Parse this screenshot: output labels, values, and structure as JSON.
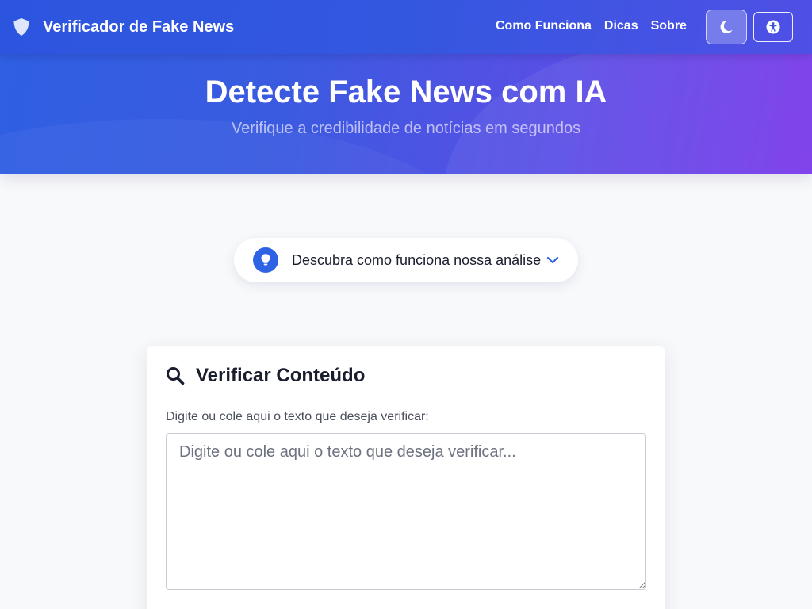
{
  "navbar": {
    "brand_title": "Verificador de Fake News",
    "brand_icon": "shield-icon",
    "links": [
      {
        "label": "Como Funciona"
      },
      {
        "label": "Dicas"
      },
      {
        "label": "Sobre"
      }
    ],
    "theme_toggle_icon": "moon-icon",
    "accessibility_icon": "accessibility-icon"
  },
  "hero": {
    "title": "Detecte Fake News com IA",
    "subtitle": "Verifique a credibilidade de notícias em segundos"
  },
  "how_it_works": {
    "label": "Descubra como funciona nossa análise",
    "icon": "lightbulb-icon",
    "expand_icon": "chevron-down-icon"
  },
  "verify_card": {
    "title": "Verificar Conteúdo",
    "title_icon": "search-icon",
    "field_label": "Digite ou cole aqui o texto que deseja verificar:",
    "textarea_value": "",
    "textarea_placeholder": "Digite ou cole aqui o texto que deseja verificar..."
  },
  "colors": {
    "primary": "#2f63e6",
    "gradient_start": "#2f5fe3",
    "gradient_end": "#7a38ea",
    "background": "#f8f9fb"
  }
}
